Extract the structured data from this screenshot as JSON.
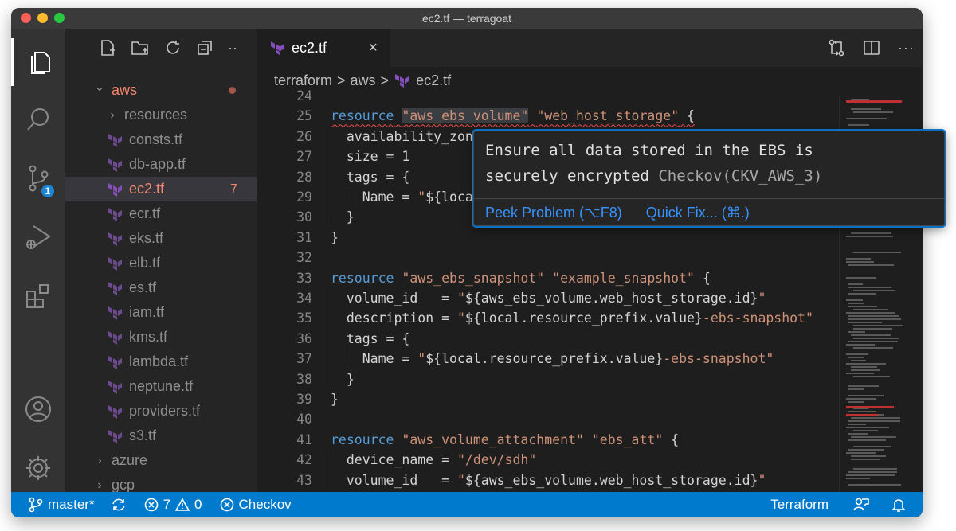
{
  "window": {
    "title": "ec2.tf — terragoat",
    "traffic_lights": [
      "#fe5f57",
      "#febc2e",
      "#28c840"
    ]
  },
  "activity_bar": {
    "items": [
      {
        "name": "explorer",
        "icon": "files-icon",
        "active": true
      },
      {
        "name": "search",
        "icon": "search-icon"
      },
      {
        "name": "source-control",
        "icon": "source-control-icon",
        "badge": "1"
      },
      {
        "name": "run-debug",
        "icon": "run-debug-icon"
      },
      {
        "name": "extensions",
        "icon": "extensions-icon"
      }
    ],
    "bottom": [
      {
        "name": "accounts",
        "icon": "account-icon"
      },
      {
        "name": "manage",
        "icon": "gear-icon"
      }
    ]
  },
  "sidebar": {
    "toolbar_icons": [
      "new-file-icon",
      "new-folder-icon",
      "refresh-icon",
      "collapse-all-icon"
    ],
    "toolbar_more": "··",
    "tree": [
      {
        "label": "aws",
        "type": "folder-open",
        "indent": 0
      },
      {
        "label": "resources",
        "type": "folder",
        "indent": 1
      },
      {
        "label": "consts.tf",
        "type": "file",
        "indent": 1
      },
      {
        "label": "db-app.tf",
        "type": "file",
        "indent": 1
      },
      {
        "label": "ec2.tf",
        "type": "file",
        "indent": 1,
        "selected": true,
        "count": "7"
      },
      {
        "label": "ecr.tf",
        "type": "file",
        "indent": 1
      },
      {
        "label": "eks.tf",
        "type": "file",
        "indent": 1
      },
      {
        "label": "elb.tf",
        "type": "file",
        "indent": 1
      },
      {
        "label": "es.tf",
        "type": "file",
        "indent": 1
      },
      {
        "label": "iam.tf",
        "type": "file",
        "indent": 1
      },
      {
        "label": "kms.tf",
        "type": "file",
        "indent": 1
      },
      {
        "label": "lambda.tf",
        "type": "file",
        "indent": 1
      },
      {
        "label": "neptune.tf",
        "type": "file",
        "indent": 1
      },
      {
        "label": "providers.tf",
        "type": "file",
        "indent": 1
      },
      {
        "label": "s3.tf",
        "type": "file",
        "indent": 1
      },
      {
        "label": "azure",
        "type": "folder",
        "indent": 0
      },
      {
        "label": "gcp",
        "type": "folder",
        "indent": 0
      }
    ]
  },
  "editor": {
    "tab": {
      "label": "ec2.tf",
      "close": "×"
    },
    "tab_actions": [
      "compare-changes-icon",
      "split-editor-icon",
      "more-actions-icon"
    ],
    "more_actions": "···",
    "breadcrumb": [
      "terraform",
      "aws",
      "ec2.tf"
    ],
    "breadcrumb_sep": ">",
    "lines": [
      {
        "n": "24",
        "t": ""
      },
      {
        "n": "25",
        "t": "resource \"aws_ebs_volume\" \"web_host_storage\" {"
      },
      {
        "n": "26",
        "t": "  availability_zone = \"${var.availability_zone}\""
      },
      {
        "n": "27",
        "t": "  size = 1"
      },
      {
        "n": "28",
        "t": "  tags = {"
      },
      {
        "n": "29",
        "t": "    Name = \"${local.resource_prefix.value}-ebs\""
      },
      {
        "n": "30",
        "t": "  }"
      },
      {
        "n": "31",
        "t": "}"
      },
      {
        "n": "32",
        "t": ""
      },
      {
        "n": "33",
        "t": "resource \"aws_ebs_snapshot\" \"example_snapshot\" {"
      },
      {
        "n": "34",
        "t": "  volume_id   = \"${aws_ebs_volume.web_host_storage.id}\""
      },
      {
        "n": "35",
        "t": "  description = \"${local.resource_prefix.value}-ebs-snapshot\""
      },
      {
        "n": "36",
        "t": "  tags = {"
      },
      {
        "n": "37",
        "t": "    Name = \"${local.resource_prefix.value}-ebs-snapshot\""
      },
      {
        "n": "38",
        "t": "  }"
      },
      {
        "n": "39",
        "t": "}"
      },
      {
        "n": "40",
        "t": ""
      },
      {
        "n": "41",
        "t": "resource \"aws_volume_attachment\" \"ebs_att\" {"
      },
      {
        "n": "42",
        "t": "  device_name = \"/dev/sdh\""
      },
      {
        "n": "43",
        "t": "  volume_id   = \"${aws_ebs_volume.web_host_storage.id}\""
      }
    ]
  },
  "hover": {
    "message_line1": "Ensure all data stored in the EBS is",
    "message_line2": "securely encrypted",
    "source": "Checkov",
    "code_open": "(",
    "code": "CKV_AWS_3",
    "code_close": ")",
    "peek_problem": "Peek Problem (⌥F8)",
    "quick_fix": "Quick Fix... (⌘.)"
  },
  "status_bar": {
    "branch": "master*",
    "errors": "7",
    "warnings": "0",
    "checkov": "Checkov",
    "language": "Terraform",
    "accent": "#007acc"
  }
}
